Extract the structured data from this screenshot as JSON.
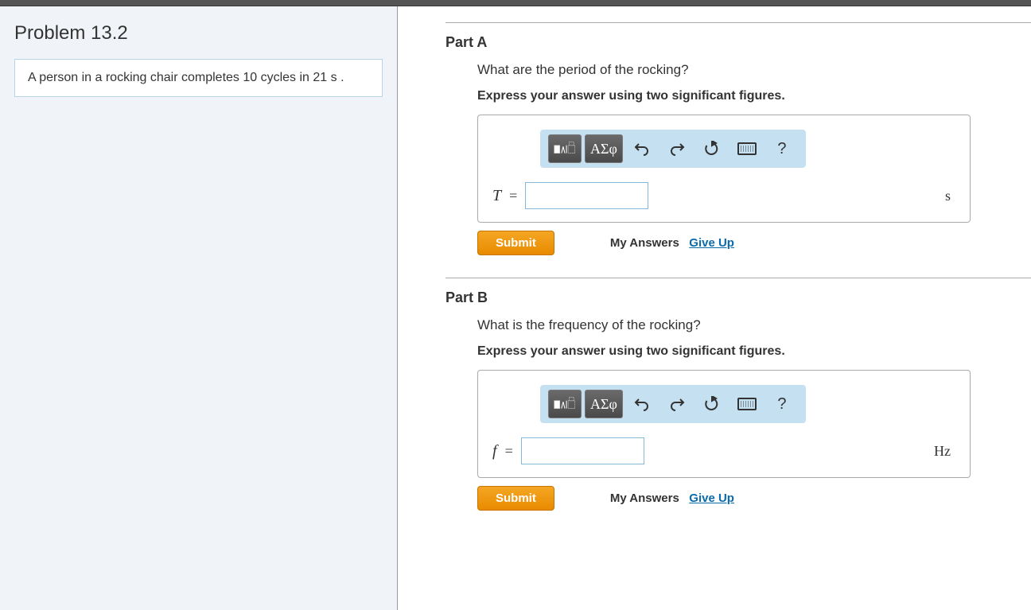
{
  "problem": {
    "title": "Problem 13.2",
    "description": "A person in a rocking chair completes 10 cycles in 21 s ."
  },
  "parts": [
    {
      "label": "Part A",
      "question": "What are the period of the rocking?",
      "instruction": "Express your answer using two significant figures.",
      "variable": "T",
      "unit": "s",
      "value": ""
    },
    {
      "label": "Part B",
      "question": "What is the frequency of the rocking?",
      "instruction": "Express your answer using two significant figures.",
      "variable": "f",
      "unit": "Hz",
      "value": ""
    }
  ],
  "toolbar": {
    "greek_label": "ΑΣφ",
    "help_label": "?"
  },
  "actions": {
    "submit": "Submit",
    "my_answers": "My Answers",
    "give_up": "Give Up"
  }
}
